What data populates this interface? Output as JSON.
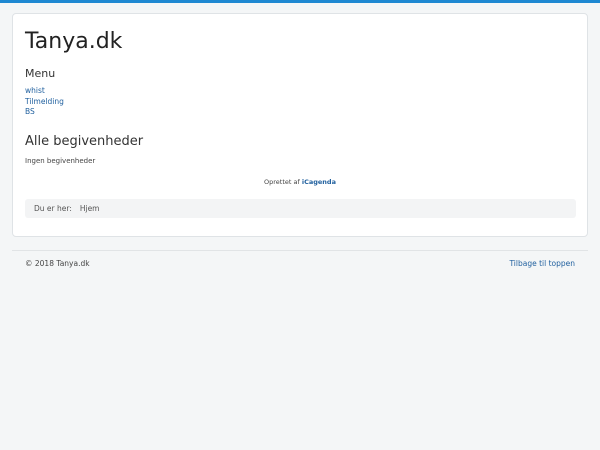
{
  "site": {
    "title": "Tanya.dk"
  },
  "menu": {
    "heading": "Menu",
    "items": [
      {
        "label": "whist"
      },
      {
        "label": "Tilmelding"
      },
      {
        "label": "BS"
      }
    ]
  },
  "events": {
    "heading": "Alle begivenheder",
    "empty_text": "Ingen begivenheder"
  },
  "credit": {
    "prefix": "Oprettet af",
    "link": "iCagenda"
  },
  "breadcrumb": {
    "label": "Du er her:",
    "home": "Hjem"
  },
  "footer": {
    "copyright": "© 2018 Tanya.dk",
    "back_to_top": "Tilbage til toppen"
  },
  "colors": {
    "accent": "#1e88d2",
    "link": "#1f5f9e",
    "background": "#f4f6f7"
  }
}
